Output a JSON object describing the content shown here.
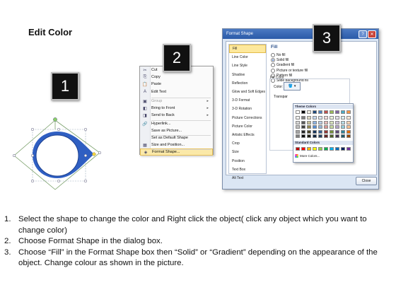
{
  "title": "Edit Color",
  "badges": [
    "1",
    "2",
    "3"
  ],
  "context_menu": {
    "items": [
      {
        "icon": "✂",
        "label": "Cut",
        "arrow": "",
        "disabled": false,
        "highlight": false
      },
      {
        "icon": "⎘",
        "label": "Copy",
        "arrow": "",
        "disabled": false,
        "highlight": false
      },
      {
        "icon": "📋",
        "label": "Paste",
        "arrow": "",
        "disabled": false,
        "highlight": false
      },
      {
        "icon": "A",
        "label": "Edit Text",
        "arrow": "",
        "disabled": false,
        "highlight": false
      },
      {
        "icon": "▣",
        "label": "Group",
        "arrow": "▸",
        "disabled": true,
        "highlight": false
      },
      {
        "icon": "◧",
        "label": "Bring to Front",
        "arrow": "▸",
        "disabled": false,
        "highlight": false
      },
      {
        "icon": "◨",
        "label": "Send to Back",
        "arrow": "▸",
        "disabled": false,
        "highlight": false
      },
      {
        "icon": "🔗",
        "label": "Hyperlink...",
        "arrow": "",
        "disabled": false,
        "highlight": false
      },
      {
        "icon": "",
        "label": "Save as Picture...",
        "arrow": "",
        "disabled": false,
        "highlight": false
      },
      {
        "icon": "",
        "label": "Set as Default Shape",
        "arrow": "",
        "disabled": false,
        "highlight": false
      },
      {
        "icon": "▦",
        "label": "Size and Position...",
        "arrow": "",
        "disabled": false,
        "highlight": false
      },
      {
        "icon": "◈",
        "label": "Format Shape...",
        "arrow": "",
        "disabled": false,
        "highlight": true
      }
    ]
  },
  "dialog": {
    "title": "Format Shape",
    "help": "?",
    "close_x": "✕",
    "categories": [
      "Fill",
      "Line Color",
      "Line Style",
      "Shadow",
      "Reflection",
      "Glow and Soft Edges",
      "3-D Format",
      "3-D Rotation",
      "Picture Corrections",
      "Picture Color",
      "Artistic Effects",
      "Crop",
      "Size",
      "Position",
      "Text Box",
      "Alt Text"
    ],
    "selected_category": "Fill",
    "section_title": "Fill",
    "fill_options": [
      {
        "label": "No fill",
        "checked": false
      },
      {
        "label": "Solid fill",
        "checked": true
      },
      {
        "label": "Gradient fill",
        "checked": false
      },
      {
        "label": "Picture or texture fill",
        "checked": false
      },
      {
        "label": "Pattern fill",
        "checked": false
      },
      {
        "label": "Slide background fill",
        "checked": false
      }
    ],
    "fill_color_label": "Fill Color",
    "color_label": "Color:",
    "transparency_label": "Transpar",
    "close_button": "Close"
  },
  "palette": {
    "theme_header": "Theme Colors",
    "standard_header": "Standard Colors",
    "more_colors": "More Colors...",
    "theme_top": [
      "#ffffff",
      "#000000",
      "#eeece1",
      "#1f497d",
      "#4f81bd",
      "#c0504d",
      "#9bbb59",
      "#8064a2",
      "#4bacc6",
      "#f79646"
    ],
    "theme_shades": [
      [
        "#f2f2f2",
        "#7f7f7f",
        "#ddd9c3",
        "#c6d9f0",
        "#dbe5f1",
        "#f2dcdb",
        "#ebf1dd",
        "#e5e0ec",
        "#dbeef3",
        "#fdeada"
      ],
      [
        "#d8d8d8",
        "#595959",
        "#c4bd97",
        "#8db3e2",
        "#b8cce4",
        "#e5b9b7",
        "#d7e3bc",
        "#ccc1d9",
        "#b7dde8",
        "#fbd5b5"
      ],
      [
        "#bfbfbf",
        "#3f3f3f",
        "#938953",
        "#548dd4",
        "#95b3d7",
        "#d99694",
        "#c3d69b",
        "#b2a2c7",
        "#92cddc",
        "#fac08f"
      ],
      [
        "#a5a5a5",
        "#262626",
        "#494429",
        "#17365d",
        "#366092",
        "#953734",
        "#76923c",
        "#5f497a",
        "#31859b",
        "#e36c09"
      ],
      [
        "#7f7f7f",
        "#0c0c0c",
        "#1d1b10",
        "#0f243e",
        "#244061",
        "#632423",
        "#4f6128",
        "#3f3151",
        "#205867",
        "#974806"
      ]
    ],
    "standard": [
      "#c00000",
      "#ff0000",
      "#ffc000",
      "#ffff00",
      "#92d050",
      "#00b050",
      "#00b0f0",
      "#0070c0",
      "#002060",
      "#7030a0"
    ]
  },
  "steps": [
    {
      "num": "1.",
      "text": "Select the shape to change the color and Right click the object( click any object which you want to change color)"
    },
    {
      "num": "2.",
      "text": "Choose Format Shape in the dialog box."
    },
    {
      "num": "3.",
      "text": "Choose “Fill” in the Format Shape box then “Solid” or “Gradient” depending on the appearance of the object. Change colour as shown in the picture."
    }
  ]
}
